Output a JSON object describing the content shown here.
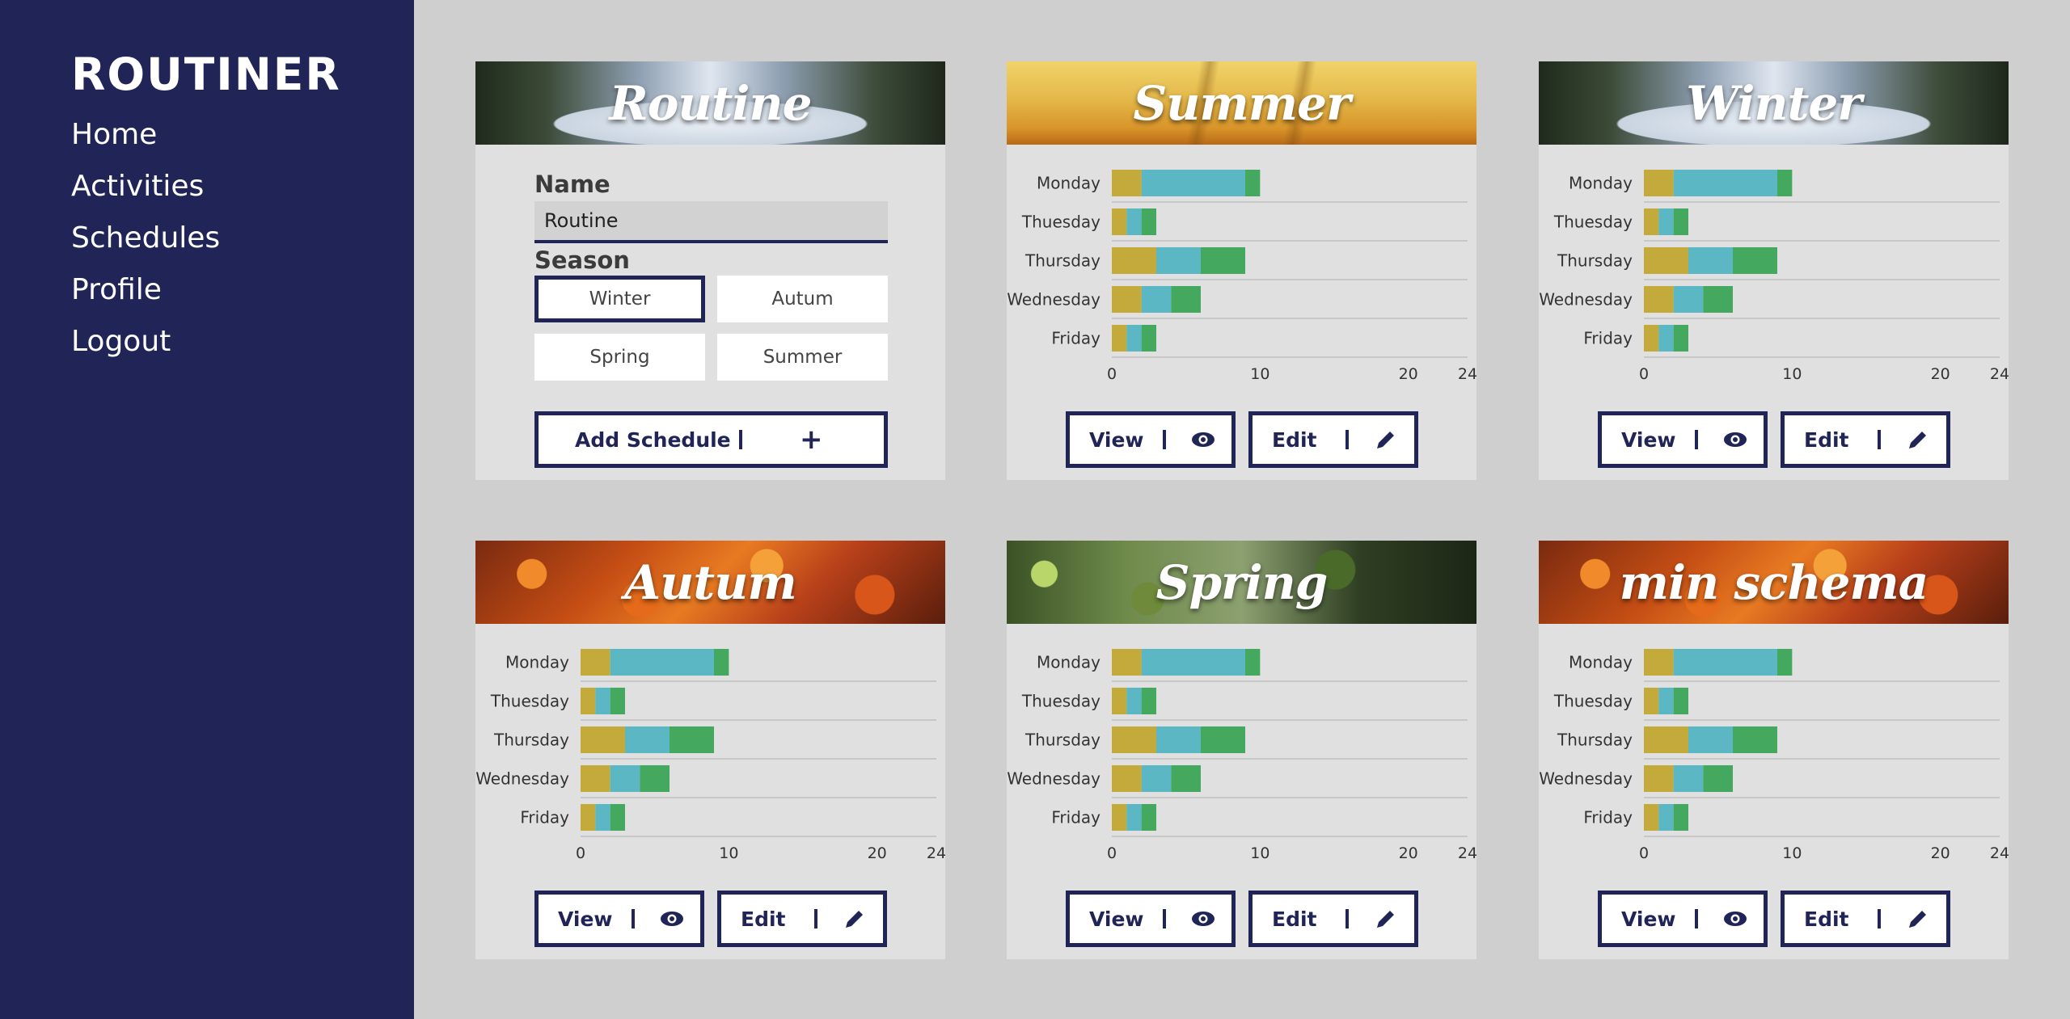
{
  "app": {
    "brand": "ROUTINER"
  },
  "nav": [
    "Home",
    "Activities",
    "Schedules",
    "Profile",
    "Logout"
  ],
  "form_card": {
    "title": "Routine",
    "name_label": "Name",
    "name_value": "Routine",
    "season_label": "Season",
    "seasons": [
      "Winter",
      "Autum",
      "Spring",
      "Summer"
    ],
    "selected_season": "Winter",
    "add_button": "Add Schedule",
    "add_icon": "+"
  },
  "buttons": {
    "view": "View",
    "edit": "Edit"
  },
  "colors": {
    "sidebar": "#212457",
    "seg1": "#c4aa3a",
    "seg2": "#5bb7c3",
    "seg3": "#45a85f"
  },
  "schedules": [
    {
      "title": "Summer",
      "theme": "summer",
      "chart_data": {
        "type": "bar",
        "orientation": "horizontal",
        "stacked": true,
        "categories": [
          "Monday",
          "Thuesday",
          "Thursday",
          "Wednesday",
          "Friday"
        ],
        "series": [
          {
            "values": [
              2,
              1,
              3,
              2,
              1
            ]
          },
          {
            "values": [
              7,
              1,
              3,
              2,
              1
            ]
          },
          {
            "values": [
              1,
              1,
              3,
              2,
              1
            ]
          }
        ],
        "xticks": [
          "0",
          "10",
          "20",
          "24"
        ],
        "xlim": [
          0,
          24
        ],
        "grid": true
      }
    },
    {
      "title": "Winter",
      "theme": "winter",
      "chart_data": {
        "type": "bar",
        "orientation": "horizontal",
        "stacked": true,
        "categories": [
          "Monday",
          "Thuesday",
          "Thursday",
          "Wednesday",
          "Friday"
        ],
        "series": [
          {
            "values": [
              2,
              1,
              3,
              2,
              1
            ]
          },
          {
            "values": [
              7,
              1,
              3,
              2,
              1
            ]
          },
          {
            "values": [
              1,
              1,
              3,
              2,
              1
            ]
          }
        ],
        "xticks": [
          "0",
          "10",
          "20",
          "24"
        ],
        "xlim": [
          0,
          24
        ],
        "grid": true
      }
    },
    {
      "title": "Autum",
      "theme": "autumn",
      "chart_data": {
        "type": "bar",
        "orientation": "horizontal",
        "stacked": true,
        "categories": [
          "Monday",
          "Thuesday",
          "Thursday",
          "Wednesday",
          "Friday"
        ],
        "series": [
          {
            "values": [
              2,
              1,
              3,
              2,
              1
            ]
          },
          {
            "values": [
              7,
              1,
              3,
              2,
              1
            ]
          },
          {
            "values": [
              1,
              1,
              3,
              2,
              1
            ]
          }
        ],
        "xticks": [
          "0",
          "10",
          "20",
          "24"
        ],
        "xlim": [
          0,
          24
        ],
        "grid": true
      }
    },
    {
      "title": "Spring",
      "theme": "spring",
      "chart_data": {
        "type": "bar",
        "orientation": "horizontal",
        "stacked": true,
        "categories": [
          "Monday",
          "Thuesday",
          "Thursday",
          "Wednesday",
          "Friday"
        ],
        "series": [
          {
            "values": [
              2,
              1,
              3,
              2,
              1
            ]
          },
          {
            "values": [
              7,
              1,
              3,
              2,
              1
            ]
          },
          {
            "values": [
              1,
              1,
              3,
              2,
              1
            ]
          }
        ],
        "xticks": [
          "0",
          "10",
          "20",
          "24"
        ],
        "xlim": [
          0,
          24
        ],
        "grid": true
      }
    },
    {
      "title": "min schema",
      "theme": "autumn",
      "chart_data": {
        "type": "bar",
        "orientation": "horizontal",
        "stacked": true,
        "categories": [
          "Monday",
          "Thuesday",
          "Thursday",
          "Wednesday",
          "Friday"
        ],
        "series": [
          {
            "values": [
              2,
              1,
              3,
              2,
              1
            ]
          },
          {
            "values": [
              7,
              1,
              3,
              2,
              1
            ]
          },
          {
            "values": [
              1,
              1,
              3,
              2,
              1
            ]
          }
        ],
        "xticks": [
          "0",
          "10",
          "20",
          "24"
        ],
        "xlim": [
          0,
          24
        ],
        "grid": true
      }
    }
  ]
}
